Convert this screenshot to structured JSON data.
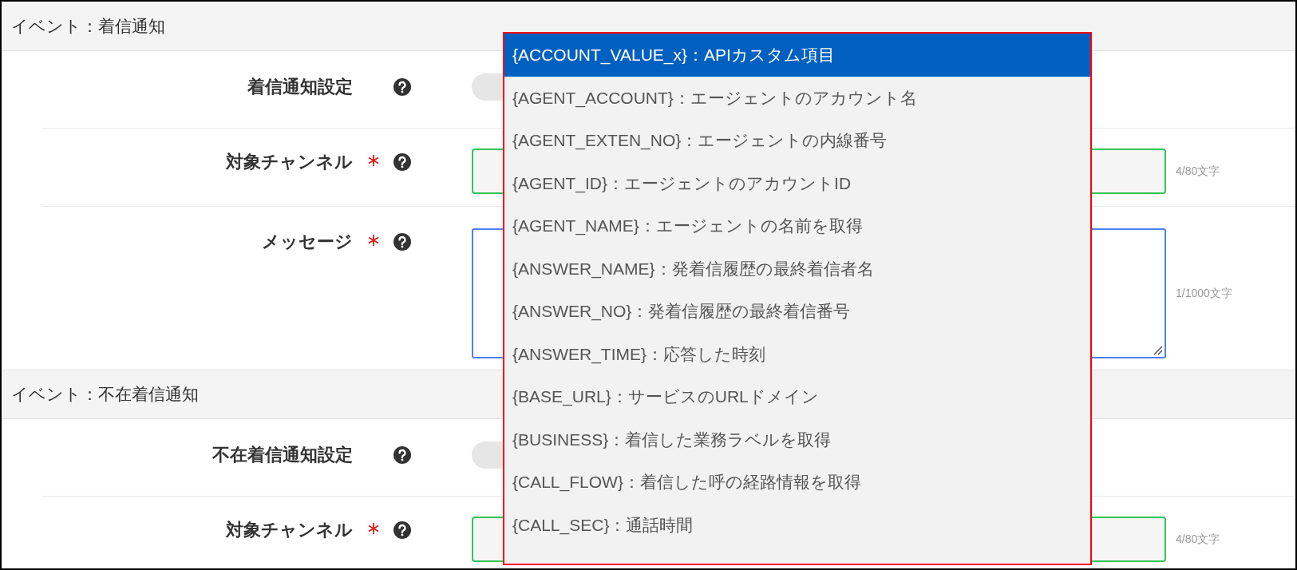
{
  "sections": [
    {
      "title": "イベント：着信通知",
      "rows": [
        {
          "label": "着信通知設定",
          "required": false,
          "kind": "toggle",
          "on": false
        },
        {
          "label": "対象チャンネル",
          "required": true,
          "kind": "text",
          "counter": "4/80文字"
        },
        {
          "label": "メッセージ",
          "required": true,
          "kind": "textarea",
          "counter": "1/1000文字"
        }
      ]
    },
    {
      "title": "イベント：不在着信通知",
      "rows": [
        {
          "label": "不在着信通知設定",
          "required": false,
          "kind": "toggle",
          "on": false
        },
        {
          "label": "対象チャンネル",
          "required": true,
          "kind": "text",
          "counter": "4/80文字"
        }
      ]
    }
  ],
  "dropdown": {
    "items": [
      {
        "label": "{ACCOUNT_VALUE_x}：APIカスタム項目",
        "selected": true
      },
      {
        "label": "{AGENT_ACCOUNT}：エージェントのアカウント名",
        "selected": false
      },
      {
        "label": "{AGENT_EXTEN_NO}：エージェントの内線番号",
        "selected": false
      },
      {
        "label": "{AGENT_ID}：エージェントのアカウントID",
        "selected": false
      },
      {
        "label": "{AGENT_NAME}：エージェントの名前を取得",
        "selected": false
      },
      {
        "label": "{ANSWER_NAME}：発着信履歴の最終着信者名",
        "selected": false
      },
      {
        "label": "{ANSWER_NO}：発着信履歴の最終着信番号",
        "selected": false
      },
      {
        "label": "{ANSWER_TIME}：応答した時刻",
        "selected": false
      },
      {
        "label": "{BASE_URL}：サービスのURLドメイン",
        "selected": false
      },
      {
        "label": "{BUSINESS}：着信した業務ラベルを取得",
        "selected": false
      },
      {
        "label": "{CALL_FLOW}：着信した呼の経路情報を取得",
        "selected": false
      },
      {
        "label": "{CALL_SEC}：通話時間",
        "selected": false
      }
    ]
  }
}
